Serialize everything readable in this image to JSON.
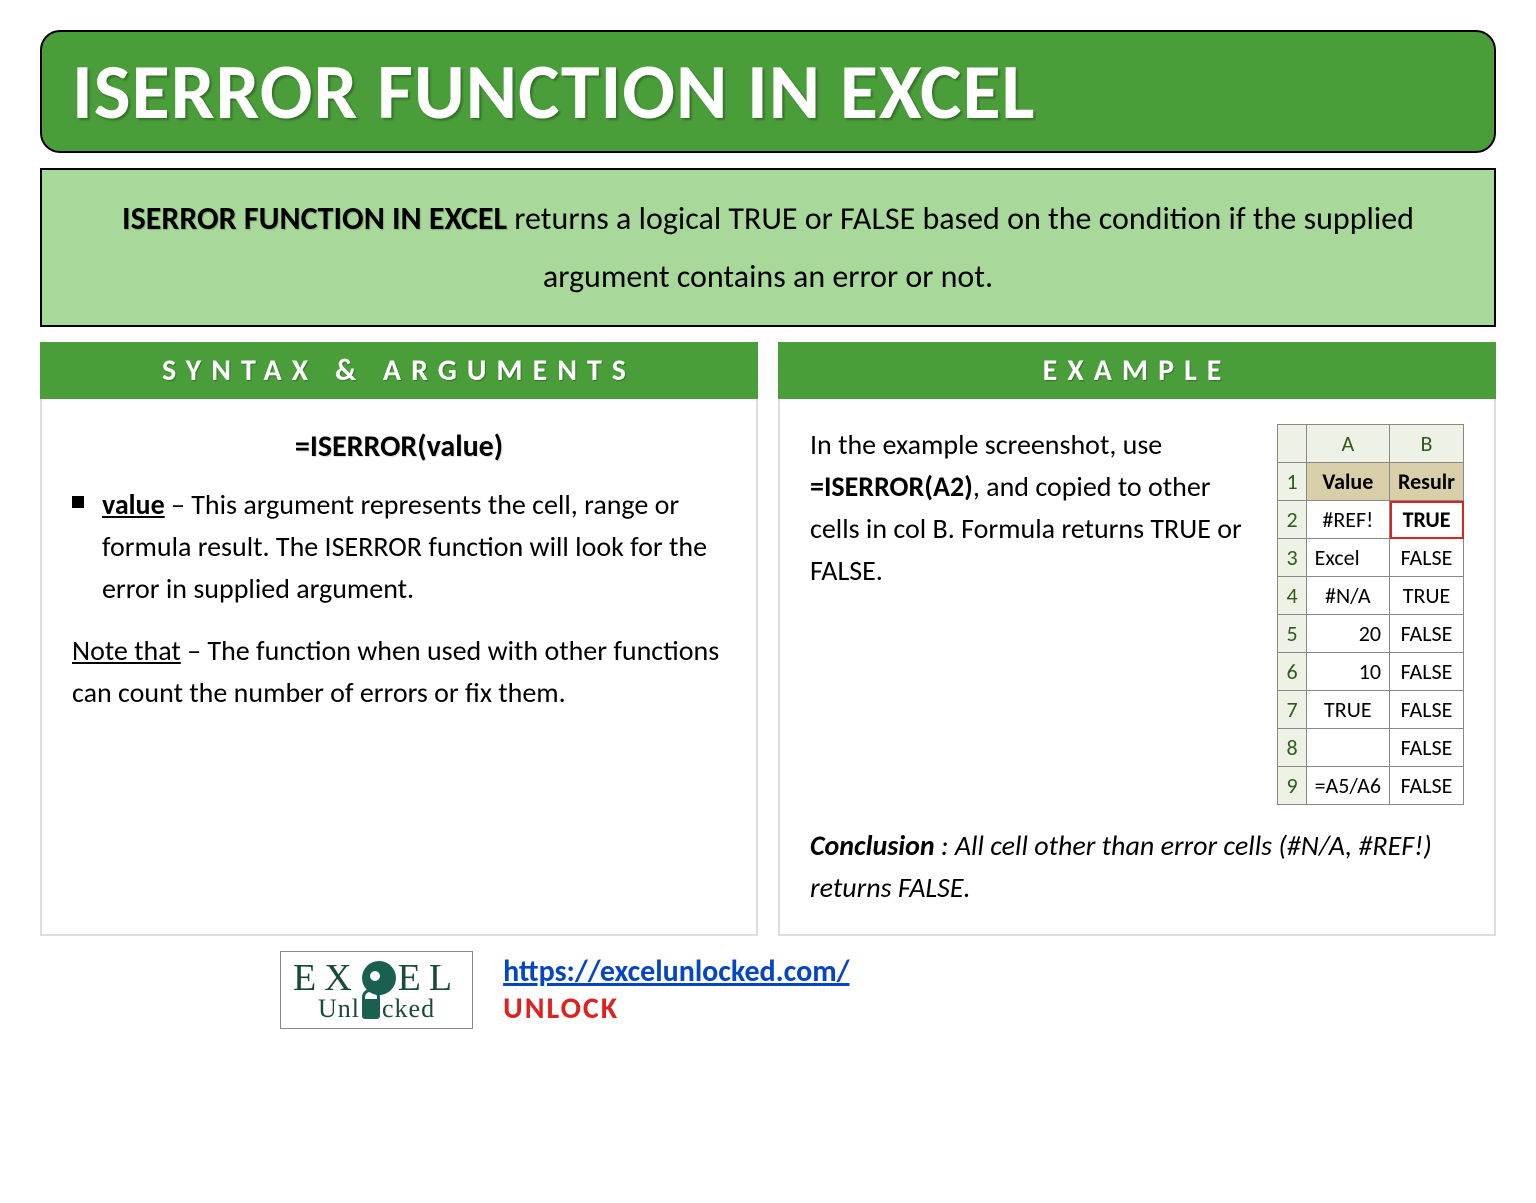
{
  "title": "ISERROR FUNCTION IN EXCEL",
  "description": {
    "strong": "ISERROR FUNCTION IN EXCEL",
    "rest": "returns a logical TRUE or FALSE based on the condition if the supplied argument contains an error or not."
  },
  "syntax": {
    "header": "SYNTAX & ARGUMENTS",
    "formula": "=ISERROR(value)",
    "arg_name": "value",
    "arg_desc": " – This argument represents the cell, range or formula result. The ISERROR function will look for the error in supplied argument.",
    "note_label": "Note that",
    "note_text": " – The function when used with other functions can count the number of errors or fix them."
  },
  "example": {
    "header": "EXAMPLE",
    "text_pre": "In the example screenshot, use ",
    "formula": "=ISERROR(A2)",
    "text_post": ", and copied to other cells in col B. Formula returns TRUE or FALSE.",
    "conclusion_label": "Conclusion",
    "conclusion_text": " : All cell other than error cells (#N/A, #REF!) returns FALSE."
  },
  "table": {
    "colA": "A",
    "colB": "B",
    "head_value": "Value",
    "head_result": "Resulr",
    "rows": [
      {
        "n": "2",
        "a": "#REF!",
        "b": "TRUE",
        "hl": true,
        "align": "center"
      },
      {
        "n": "3",
        "a": "Excel",
        "b": "FALSE",
        "align": "left"
      },
      {
        "n": "4",
        "a": "#N/A",
        "b": "TRUE",
        "align": "center"
      },
      {
        "n": "5",
        "a": "20",
        "b": "FALSE",
        "align": "right"
      },
      {
        "n": "6",
        "a": "10",
        "b": "FALSE",
        "align": "right"
      },
      {
        "n": "7",
        "a": "TRUE",
        "b": "FALSE",
        "align": "center"
      },
      {
        "n": "8",
        "a": "",
        "b": "FALSE",
        "align": "center"
      },
      {
        "n": "9",
        "a": "=A5/A6",
        "b": "FALSE",
        "align": "left"
      }
    ]
  },
  "footer": {
    "logo_top": "EXCEL",
    "logo_bottom_pre": "Unl",
    "logo_bottom_post": "cked",
    "url": "https://excelunlocked.com/",
    "unlock": "UNLOCK"
  }
}
